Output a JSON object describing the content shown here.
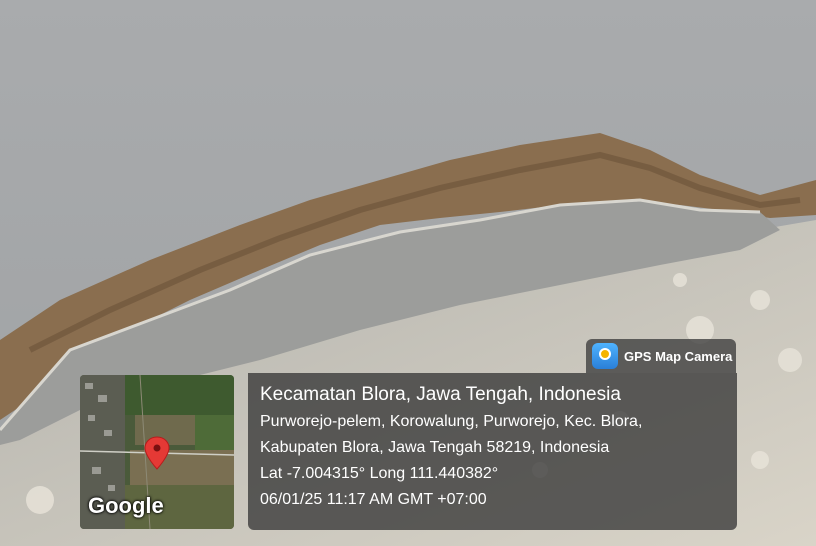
{
  "app_badge": {
    "name": "GPS Map Camera",
    "icon": "gps-map-camera-icon"
  },
  "location": {
    "title": "Kecamatan Blora, Jawa Tengah, Indonesia",
    "address_line1": "Purworejo-pelem, Korowalung, Purworejo, Kec. Blora,",
    "address_line2": "Kabupaten Blora, Jawa Tengah 58219, Indonesia",
    "coordinates": "Lat -7.004315° Long 111.440382°",
    "timestamp": "06/01/25 11:17 AM GMT +07:00"
  },
  "map_thumbnail": {
    "brand": "Google",
    "marker_icon": "map-pin-icon"
  }
}
